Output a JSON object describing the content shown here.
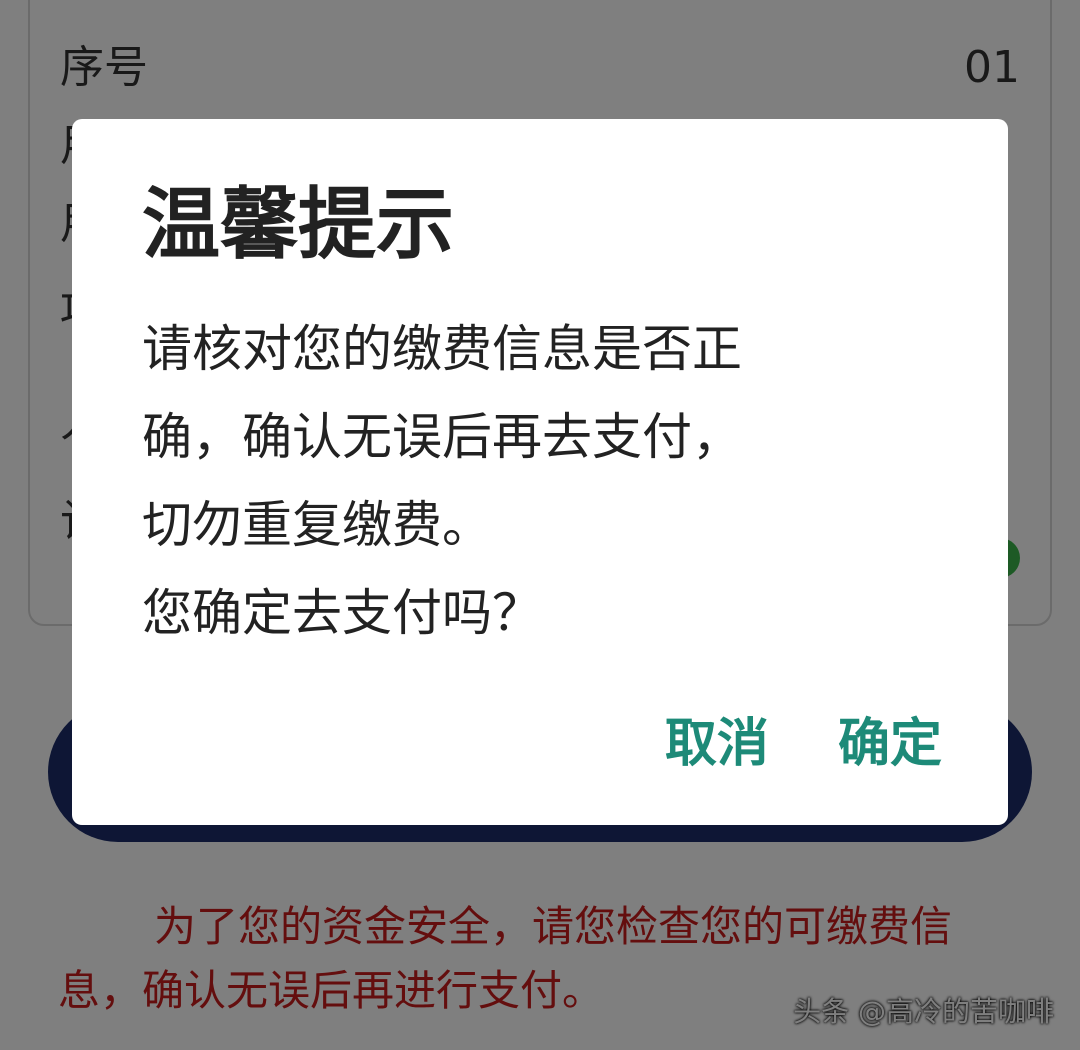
{
  "page": {
    "rows": [
      {
        "label": "序号",
        "value": "01"
      },
      {
        "label": "用",
        "value": ""
      },
      {
        "label": "用",
        "value": ""
      },
      {
        "label": "项",
        "value": ""
      },
      {
        "label": "人",
        "value": ""
      },
      {
        "label": "计",
        "value": ""
      }
    ],
    "safety_notice": "为了您的资金安全，请您检查您的可缴费信息，确认无误后再进行支付。",
    "watermark": "头条 @高冷的苦咖啡"
  },
  "dialog": {
    "title": "温馨提示",
    "message_lines": [
      "请核对您的缴费信息是否正",
      "确，确认无误后再去支付，",
      "切勿重复缴费。",
      "您确定去支付吗？"
    ],
    "cancel_label": "取消",
    "confirm_label": "确定"
  },
  "colors": {
    "accent": "#1d8a78",
    "notice_red": "#c81c1c",
    "pay_button_navy": "#1c2d6a",
    "status_green": "#3bb54a"
  }
}
